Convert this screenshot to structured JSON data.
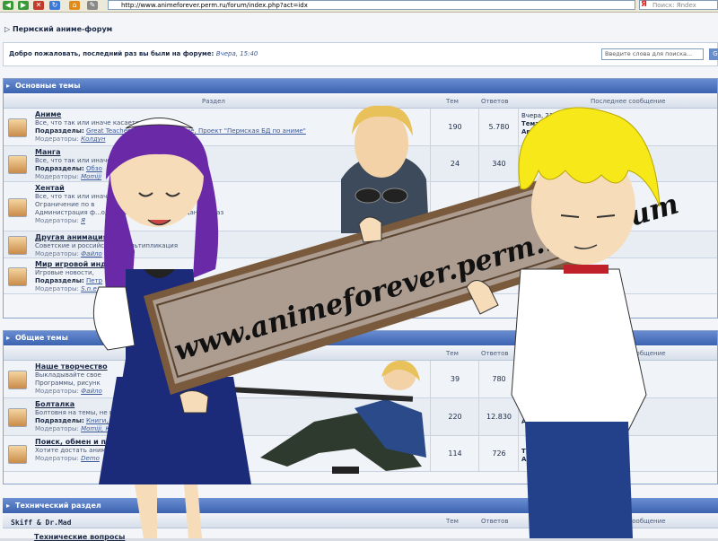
{
  "browser": {
    "url": "http://www.animeforever.perm.ru/forum/index.php?act=idx",
    "search_placeholder": "Поиск: Яndex",
    "search_logo": "Я"
  },
  "forum": {
    "title": "Пермский аниме-форум",
    "welcome": "Добро пожаловать, последний раз вы были на форуме:",
    "last_visit": "Вчера, 15:40",
    "search_placeholder": "Введите слова для поиска...",
    "search_go": "G"
  },
  "columns": {
    "section": "Раздел",
    "topics": "Тем",
    "answers": "Ответов",
    "last": "Последнее сообщение"
  },
  "categories": [
    {
      "title": "Основные темы",
      "forums": [
        {
          "name": "Аниме",
          "desc": "Все, что так или иначе касается",
          "sub_label": "Подразделы:",
          "subs": "Great Teacher...отдельных аниме, Проект \"Пермская БД по аниме\"",
          "mod_label": "Модераторы:",
          "mods": "Колдун",
          "topics": "190",
          "answers": "5.780",
          "last1": "Вчера, 21:45",
          "last2": "Тема:",
          "last3": "Автор:"
        },
        {
          "name": "Манга",
          "desc": "Все, что так или иначе",
          "sub_label": "Подразделы:",
          "subs": "Обзо",
          "mod_label": "Модераторы:",
          "mods": "Momiji",
          "topics": "24",
          "answers": "340",
          "last1": "",
          "last2": "",
          "last3": ""
        },
        {
          "name": "Хентай",
          "desc": "Все, что так или иначе",
          "desc2": "Ограничение по в",
          "desc3": "Администрация ф...одержание сообщений в данном раз",
          "sub_label": "",
          "subs": "",
          "mod_label": "Модераторы:",
          "mods": "Я",
          "topics": "",
          "answers": "",
          "last1": "",
          "last2": "",
          "last3": ""
        },
        {
          "name": "Другая анимация",
          "desc": "Советские и российские...мультипликация",
          "sub_label": "",
          "subs": "",
          "mod_label": "Модераторы:",
          "mods": "Файло",
          "topics": "",
          "answers": "",
          "last1": "",
          "last2": "",
          "last3": ""
        },
        {
          "name": "Мир игровой инду",
          "desc": "Игровые новости,",
          "sub_label": "Подразделы:",
          "subs": "Петр",
          "mod_label": "Модераторы:",
          "mods": "S.n.e.",
          "topics": "",
          "answers": "",
          "last1": "",
          "last2": "",
          "last3": ""
        }
      ]
    },
    {
      "title": "Общие темы",
      "forums": [
        {
          "name": "Наше творчество",
          "desc": "Выкладывайте свое",
          "desc2": "Программы, рисунк",
          "sub_label": "",
          "subs": "",
          "mod_label": "Модераторы:",
          "mods": "Файло",
          "topics": "39",
          "answers": "780",
          "last1": "",
          "last2": "Тема:",
          "last3": "Автор:"
        },
        {
          "name": "Болталка",
          "desc": "Болтовня на темы, не вошед",
          "sub_label": "Подразделы:",
          "subs": "Книги, музыка...ения",
          "mod_label": "Модераторы:",
          "mods": "Momiji, Колд",
          "topics": "220",
          "answers": "12.830",
          "last1": "",
          "last2": "Т",
          "last3": "А"
        },
        {
          "name": "Поиск, обмен и прод",
          "desc": "Хотите достать аниме",
          "sub_label": "",
          "subs": "",
          "mod_label": "Модераторы:",
          "mods": "Demo",
          "topics": "114",
          "answers": "726",
          "last1": "",
          "last2": "Т",
          "last3": "А"
        }
      ]
    },
    {
      "title": "Технический раздел",
      "forums": [
        {
          "name": "Технические вопросы",
          "desc": "",
          "sub_label": "",
          "subs": "",
          "mod_label": "",
          "mods": "",
          "topics": "",
          "answers": "",
          "last1": "",
          "last2": "",
          "last3": ""
        }
      ]
    }
  ],
  "overlay": {
    "sign_text": "www.animeforever.perm.ru/forum",
    "signature": "Skiff & Dr.Mad"
  },
  "colors": {
    "header_blue": "#3c63b0",
    "sign_brown": "#a8968a",
    "girl_hair": "#6a2aa8",
    "boy_hair": "#f7e81a"
  }
}
